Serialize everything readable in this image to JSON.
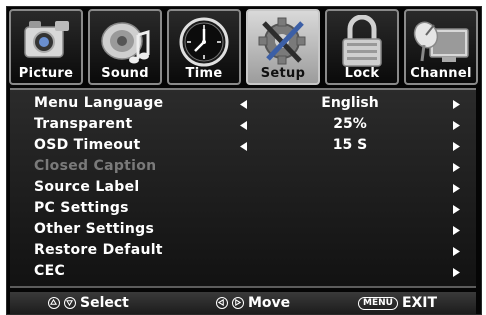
{
  "tabs": [
    {
      "label": "Picture",
      "icon": "camera-icon",
      "active": false
    },
    {
      "label": "Sound",
      "icon": "speaker-music-icon",
      "active": false
    },
    {
      "label": "Time",
      "icon": "clock-icon",
      "active": false
    },
    {
      "label": "Setup",
      "icon": "gear-tools-icon",
      "active": true
    },
    {
      "label": "Lock",
      "icon": "padlock-icon",
      "active": false
    },
    {
      "label": "Channel",
      "icon": "satellite-dish-icon",
      "active": false
    }
  ],
  "menu": {
    "items": [
      {
        "label": "Menu Language",
        "value": "English",
        "disabled": false
      },
      {
        "label": "Transparent",
        "value": "25%",
        "disabled": false
      },
      {
        "label": "OSD Timeout",
        "value": "15 S",
        "disabled": false
      },
      {
        "label": "Closed Caption",
        "value": "",
        "disabled": true
      },
      {
        "label": "Source Label",
        "value": "",
        "disabled": false
      },
      {
        "label": "PC Settings",
        "value": "",
        "disabled": false
      },
      {
        "label": "Other Settings",
        "value": "",
        "disabled": false
      },
      {
        "label": "Restore Default",
        "value": "",
        "disabled": false
      },
      {
        "label": "CEC",
        "value": "",
        "disabled": false
      }
    ]
  },
  "footer": {
    "select": "Select",
    "move": "Move",
    "menu_key": "MENU",
    "exit": "EXIT"
  },
  "colors": {
    "active_tab": "#c8c8c8",
    "text": "#ffffff",
    "disabled_text": "#7a7a7a",
    "background": "#050505"
  }
}
